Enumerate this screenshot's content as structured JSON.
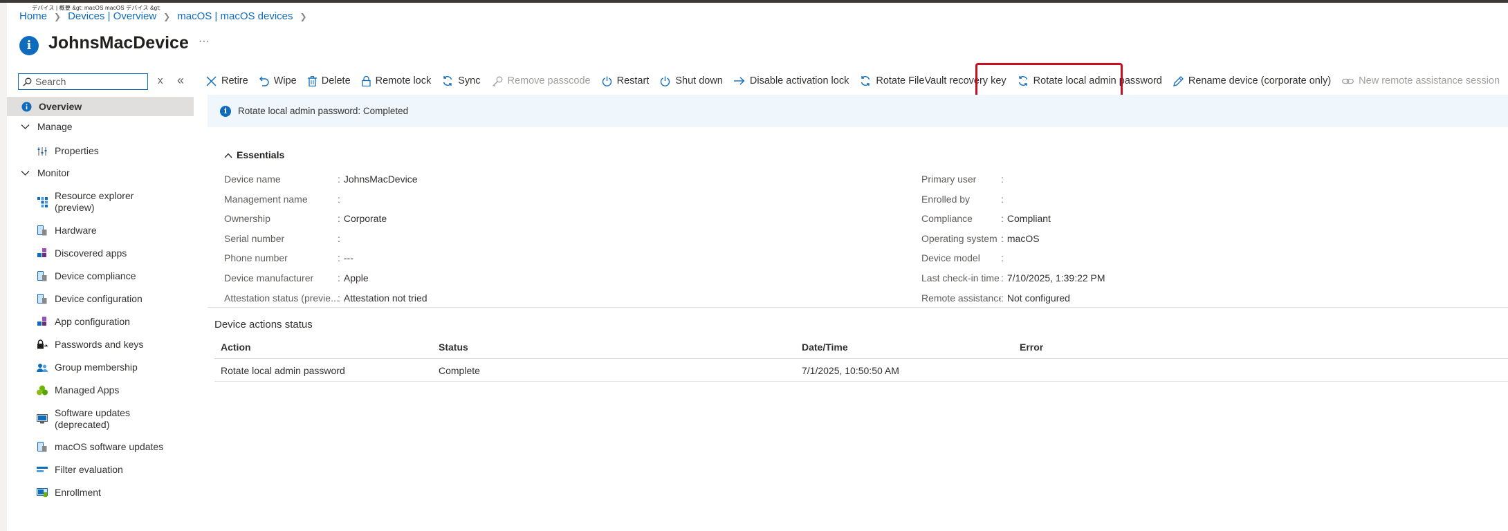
{
  "glitch_text": "デバイス | 概要 &gt; macOS macOS デバイス &gt;",
  "breadcrumb": [
    "Home",
    "Devices | Overview",
    "macOS | macOS devices"
  ],
  "title": "JohnsMacDevice",
  "title_more": "···",
  "search": {
    "placeholder": "Search",
    "clear": "x",
    "collapse": "«"
  },
  "nav": {
    "overview": "Overview",
    "manage": "Manage",
    "properties": "Properties",
    "monitor": "Monitor",
    "monitor_items": [
      "Resource explorer\n(preview)",
      "Hardware",
      "Discovered apps",
      "Device compliance",
      "Device configuration",
      "App configuration",
      "Passwords and keys",
      "Group membership",
      "Managed Apps",
      "Software updates\n(deprecated)",
      "macOS software updates",
      "Filter evaluation",
      "Enrollment"
    ]
  },
  "toolbar": {
    "retire": "Retire",
    "wipe": "Wipe",
    "delete": "Delete",
    "remote_lock": "Remote lock",
    "sync": "Sync",
    "remove_passcode": "Remove passcode",
    "restart": "Restart",
    "shut_down": "Shut down",
    "disable_activation_lock": "Disable activation lock",
    "rotate_filevault": "Rotate FileVault recovery key",
    "rotate_local_admin": "Rotate local admin password",
    "rename_device": "Rename device (corporate only)",
    "new_remote_assistance": "New remote assistance session"
  },
  "banner": "Rotate local admin password: Completed",
  "essentials": {
    "header": "Essentials",
    "left": [
      {
        "k": "Device name",
        "v": "JohnsMacDevice"
      },
      {
        "k": "Management name",
        "v": ""
      },
      {
        "k": "Ownership",
        "v": "Corporate"
      },
      {
        "k": "Serial number",
        "v": ""
      },
      {
        "k": "Phone number",
        "v": "---"
      },
      {
        "k": "Device manufacturer",
        "v": "Apple"
      },
      {
        "k": "Attestation status (previe...",
        "v": "Attestation not tried"
      }
    ],
    "right": [
      {
        "k": "Primary user",
        "v": ""
      },
      {
        "k": "Enrolled by",
        "v": ""
      },
      {
        "k": "Compliance",
        "v": "Compliant"
      },
      {
        "k": "Operating system",
        "v": "macOS"
      },
      {
        "k": "Device model",
        "v": ""
      },
      {
        "k": "Last check-in time",
        "v": "7/10/2025, 1:39:22 PM"
      },
      {
        "k": "Remote assistance",
        "v": "Not configured"
      }
    ]
  },
  "actions_status": {
    "title": "Device actions status",
    "columns": [
      "Action",
      "Status",
      "Date/Time",
      "Error"
    ],
    "rows": [
      [
        "Rotate local admin password",
        "Complete",
        "7/1/2025, 10:50:50 AM",
        ""
      ]
    ]
  },
  "colors": {
    "accent": "#0f6cbd",
    "highlight": "#c50f1f",
    "banner_bg": "#eff6fc",
    "selected_nav": "#e1dfdd"
  }
}
